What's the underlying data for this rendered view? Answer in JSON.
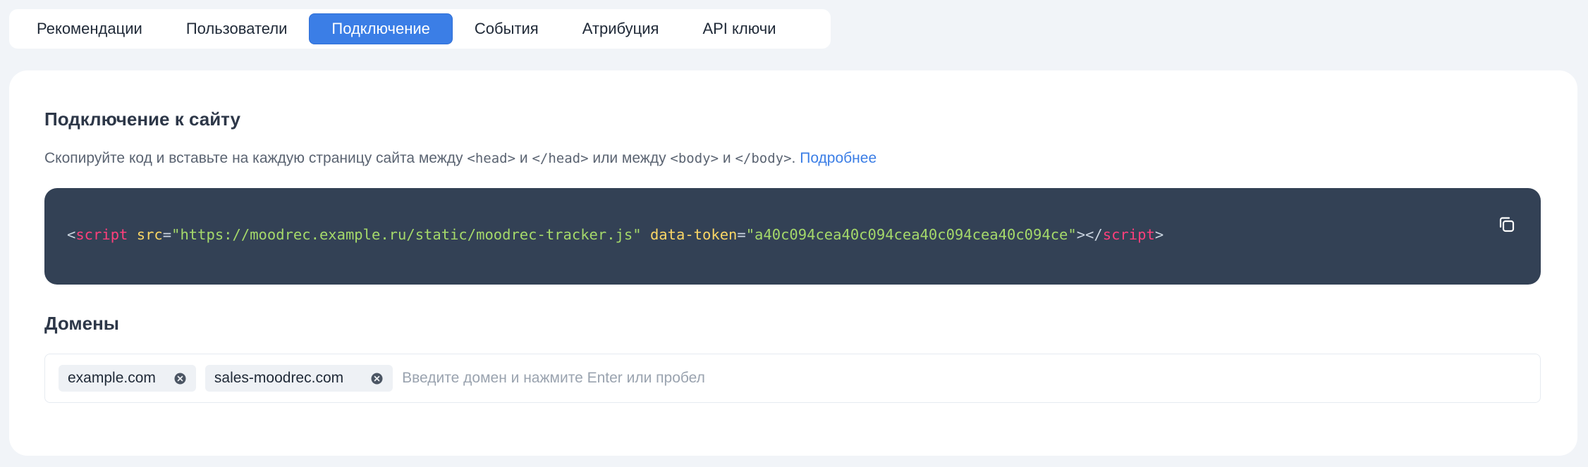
{
  "tabs": [
    {
      "label": "Рекомендации",
      "active": false
    },
    {
      "label": "Пользователи",
      "active": false
    },
    {
      "label": "Подключение",
      "active": true
    },
    {
      "label": "События",
      "active": false
    },
    {
      "label": "Атрибуция",
      "active": false
    },
    {
      "label": "API ключи",
      "active": false
    }
  ],
  "connect": {
    "title": "Подключение к сайту",
    "description": {
      "part1": "Скопируйте код и вставьте на каждую страницу сайта между ",
      "head_open": "<head>",
      "and1": " и ",
      "head_close": "</head>",
      "or": " или между ",
      "body_open": "<body>",
      "and2": " и ",
      "body_close": "</body>",
      "period": ". ",
      "link": "Подробнее"
    },
    "code": {
      "lt": "<",
      "tag": "script",
      "attr_src": "src",
      "eq1": "=",
      "src_value": "\"https://moodrec.example.ru/static/moodrec-tracker.js\"",
      "attr_token": "data-token",
      "eq2": "=",
      "token_value": "\"a40c094cea40c094cea40c094cea40c094ce\"",
      "close_open": "></",
      "close_tag": "script",
      "gt": ">"
    },
    "copy_icon": "copy-icon"
  },
  "domains": {
    "title": "Домены",
    "chips": [
      {
        "label": "example.com"
      },
      {
        "label": "sales-moodrec.com"
      }
    ],
    "input_value": "",
    "input_placeholder": "Введите домен и нажмите Enter или пробел"
  },
  "colors": {
    "accent": "#3b7ee6",
    "code_bg": "#334155",
    "code_tag": "#ff3f7b",
    "code_attr": "#fbd665",
    "code_string": "#a5d96a",
    "page_bg": "#f1f4f8"
  }
}
